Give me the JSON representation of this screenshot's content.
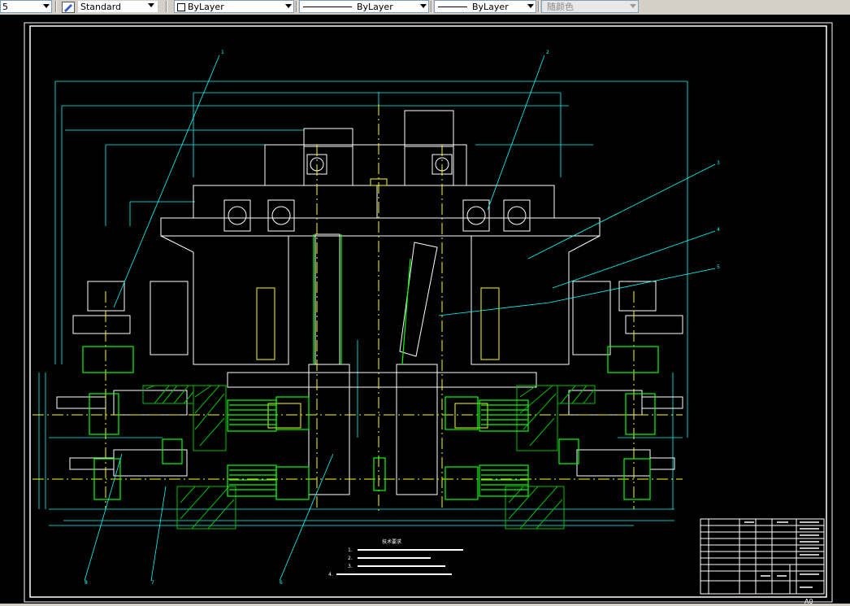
{
  "toolbar": {
    "layer_prefix": "5",
    "text_style": "Standard",
    "color": "ByLayer",
    "linetype": "ByLayer",
    "lineweight": "ByLayer",
    "plotstyle": "随颜色"
  },
  "drawing": {
    "leaders": [
      "1",
      "2",
      "3",
      "4",
      "5",
      "6",
      "7",
      "8"
    ],
    "notes_title": "技术要求",
    "notes": [
      "1.",
      "2.",
      "3.",
      "4."
    ],
    "title_block": {
      "sheet_size": "A0"
    }
  },
  "colors": {
    "canvas": "#000000",
    "dim": "#00ffff",
    "part": "#ffffff",
    "center": "#ffff00",
    "gear": "#00ff00",
    "hatch": "#00c000",
    "frame": "#ffffff"
  },
  "icons": {
    "text_style_icon": "text-style-icon",
    "color_swatch": "color-swatch-icon"
  }
}
